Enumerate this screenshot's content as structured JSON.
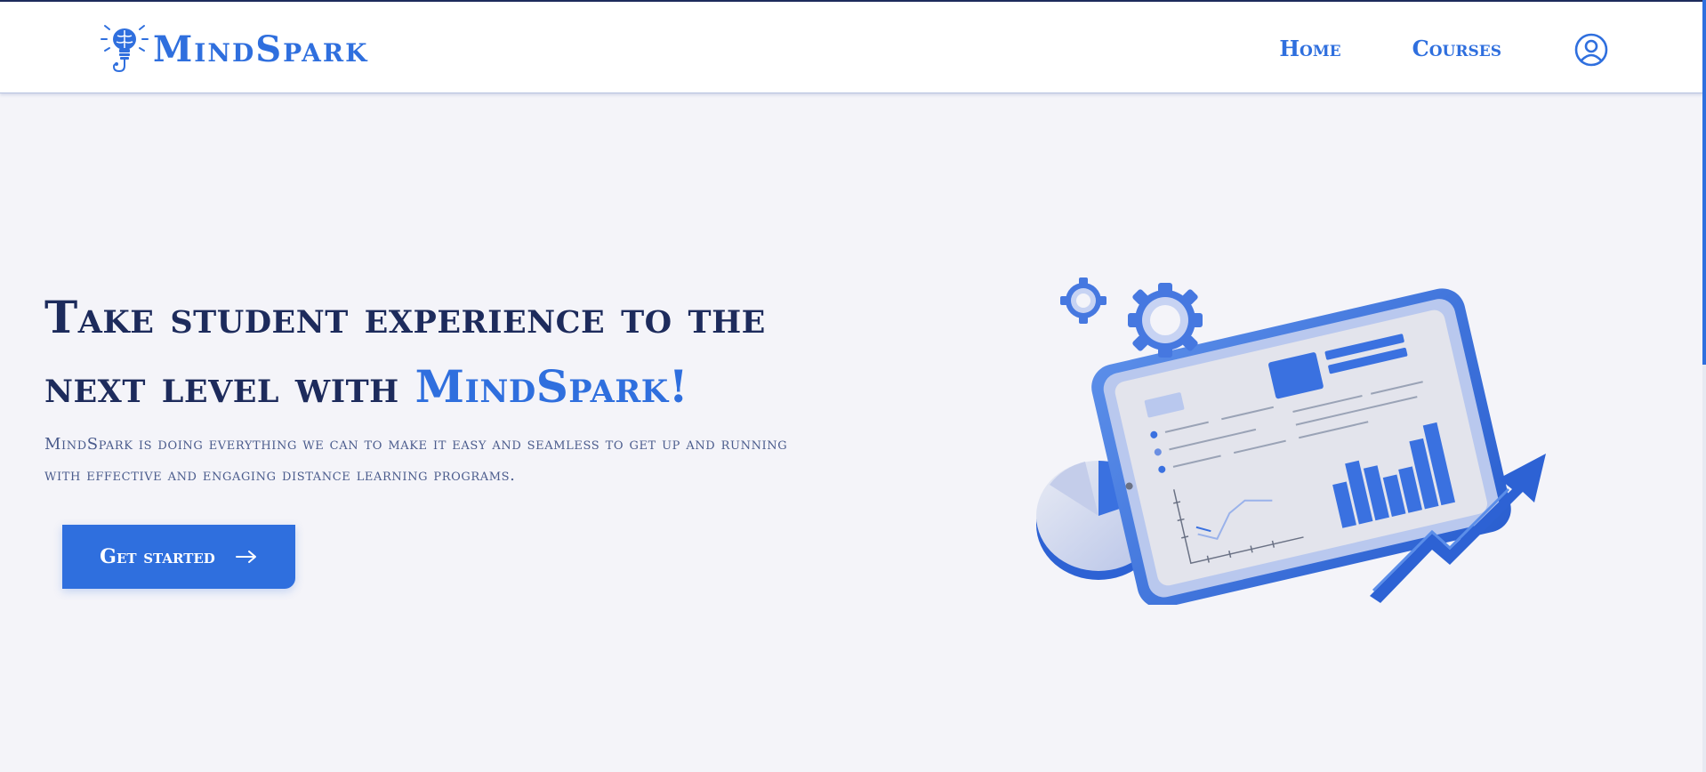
{
  "header": {
    "brand_name": "MindSpark",
    "nav": [
      {
        "label": "Home"
      },
      {
        "label": "Courses"
      }
    ],
    "account_icon": "user-circle-icon"
  },
  "hero": {
    "title_main": "Take student experience to the next level with ",
    "title_accent": "MindSpark!",
    "subtitle": "MindSpark is doing everything we can to make it easy and seamless to get up and running with effective and engaging distance learning programs.",
    "cta_label": "Get started",
    "cta_icon": "arrow-right-icon"
  },
  "colors": {
    "accent": "#2f6fde",
    "heading": "#1d2b5c",
    "background": "#f4f4f9",
    "subtitle": "#4a5b8c"
  }
}
